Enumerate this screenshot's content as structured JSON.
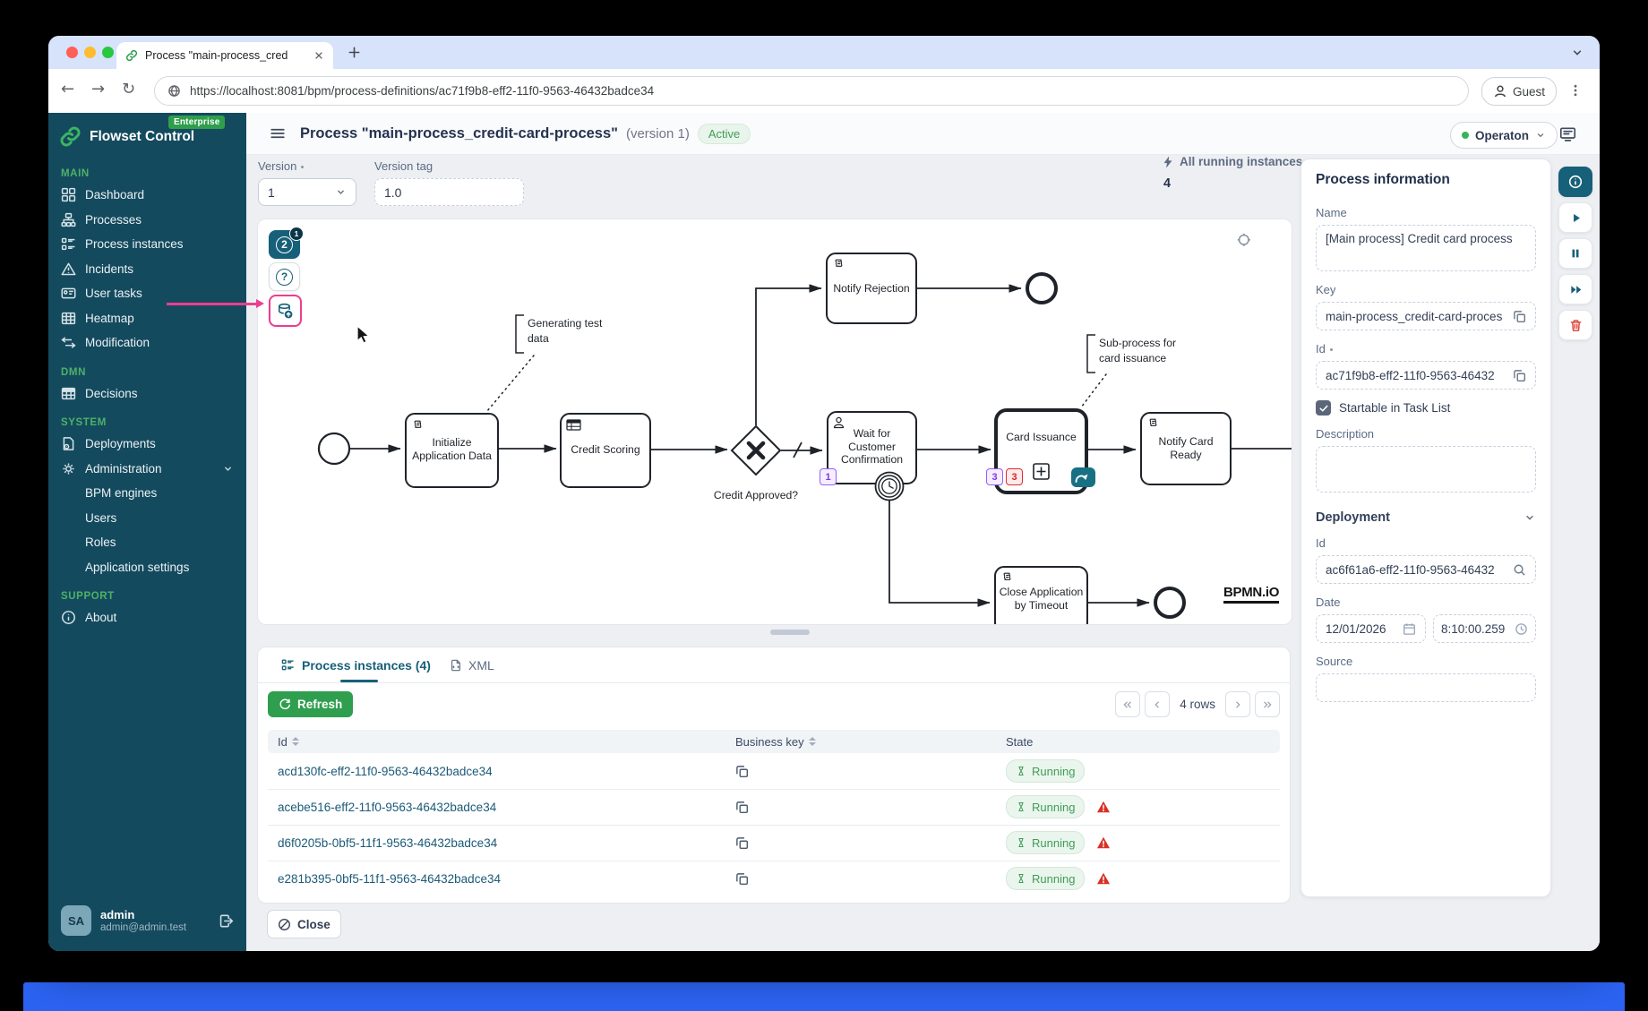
{
  "browser": {
    "tab_title": "Process \"main-process_cred",
    "url": "https://localhost:8081/bpm/process-definitions/ac71f9b8-eff2-11f0-9563-46432badce34",
    "guest": "Guest"
  },
  "sidebar": {
    "brand": "Flowset Control",
    "edition": "Enterprise",
    "s1": "MAIN",
    "s2": "DMN",
    "s3": "SYSTEM",
    "s4": "SUPPORT",
    "items": {
      "dashboard": "Dashboard",
      "processes": "Processes",
      "instances": "Process instances",
      "incidents": "Incidents",
      "usertasks": "User tasks",
      "heatmap": "Heatmap",
      "modification": "Modification",
      "decisions": "Decisions",
      "deployments": "Deployments",
      "administration": "Administration",
      "bpmengines": "BPM engines",
      "users": "Users",
      "roles": "Roles",
      "appsettings": "Application settings",
      "about": "About"
    },
    "user": {
      "initials": "SA",
      "name": "admin",
      "email": "admin@admin.test"
    }
  },
  "header": {
    "title": "Process \"main-process_credit-card-process\"",
    "version": "(version 1)",
    "status": "Active",
    "engine": "Operaton"
  },
  "controls": {
    "version_label": "Version",
    "version_value": "1",
    "tag_label": "Version tag",
    "tag_value": "1.0",
    "running_label": "All running instances",
    "running_count": "4"
  },
  "diagram": {
    "toolbar": {
      "versions": "2",
      "versions_badge": "1",
      "help": "?"
    },
    "nodes": {
      "init": "Initialize Application Data",
      "scoring": "Credit Scoring",
      "gateway": "Credit Approved?",
      "reject": "Notify Rejection",
      "wait": "Wait for Customer Confirmation",
      "card": "Card Issuance",
      "ready": "Notify Card Ready",
      "close": "Close Application by Timeout"
    },
    "annotations": {
      "a1": "Generating test data",
      "a2": "Sub-process for card issuance"
    },
    "badges": {
      "wait": "1",
      "card_active": "3",
      "card_incidents": "3"
    },
    "logo": "BPMN.iO"
  },
  "info": {
    "title": "Process information",
    "name_label": "Name",
    "name_value": "[Main process] Credit card process",
    "key_label": "Key",
    "key_value": "main-process_credit-card-proces",
    "id_label": "Id",
    "id_value": "ac71f9b8-eff2-11f0-9563-46432",
    "startable": "Startable in Task List",
    "desc_label": "Description",
    "deployment": "Deployment",
    "dep_id_label": "Id",
    "dep_id_value": "ac6f61a6-eff2-11f0-9563-46432",
    "date_label": "Date",
    "date_value": "12/01/2026",
    "time_value": "8:10:00.259",
    "source_label": "Source"
  },
  "instances": {
    "tab1": "Process instances (4)",
    "tab2": "XML",
    "refresh": "Refresh",
    "rows_info": "4 rows",
    "col_id": "Id",
    "col_bk": "Business key",
    "col_state": "State",
    "rows": [
      {
        "id": "acd130fc-eff2-11f0-9563-46432badce34",
        "state": "Running"
      },
      {
        "id": "acebe516-eff2-11f0-9563-46432badce34",
        "state": "Running"
      },
      {
        "id": "d6f0205b-0bf5-11f1-9563-46432badce34",
        "state": "Running"
      },
      {
        "id": "e281b395-0bf5-11f1-9563-46432badce34",
        "state": "Running"
      }
    ]
  },
  "footer": {
    "close": "Close"
  },
  "colors": {
    "accent_teal": "#176079",
    "brand_green": "#35b45a",
    "highlight_pink": "#ed3e8e",
    "status_green": "#3f9e55",
    "incident_red": "#d93025"
  }
}
